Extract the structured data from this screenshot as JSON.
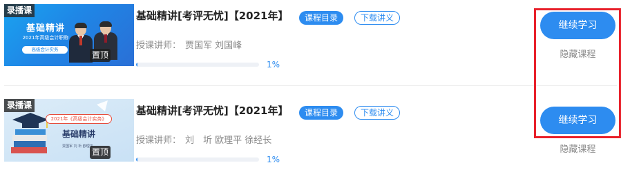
{
  "courses": [
    {
      "thumbnail": {
        "tag": "录播课",
        "pin_label": "置顶",
        "headline": "基础精讲",
        "subtitle": "2021年高级会计职称",
        "pill": "高级会计实务"
      },
      "title": "基础精讲[考评无忧]【2021年】",
      "catalog_label": "课程目录",
      "handout_label": "下载讲义",
      "teacher_label": "授课讲师：",
      "teachers": "贾国军 刘国峰",
      "progress": 0.01,
      "progress_text": "1%",
      "continue_label": "继续学习",
      "hide_label": "隐藏课程"
    },
    {
      "thumbnail": {
        "tag": "录播课",
        "pin_label": "置顶",
        "banner": "2021年《高级会计实务》",
        "headline": "基础精讲",
        "names": "贾国军 刘 圻 欧理平"
      },
      "title": "基础精讲[考评无忧]【2021年】",
      "catalog_label": "课程目录",
      "handout_label": "下载讲义",
      "teacher_label": "授课讲师：",
      "teachers": "刘　圻 欧理平 徐经长",
      "progress": 0.01,
      "progress_text": "1%",
      "continue_label": "继续学习",
      "hide_label": "隐藏课程"
    }
  ],
  "colors": {
    "accent": "#2d8cf0",
    "highlight_border": "#e8202a",
    "muted_text": "#888888"
  }
}
